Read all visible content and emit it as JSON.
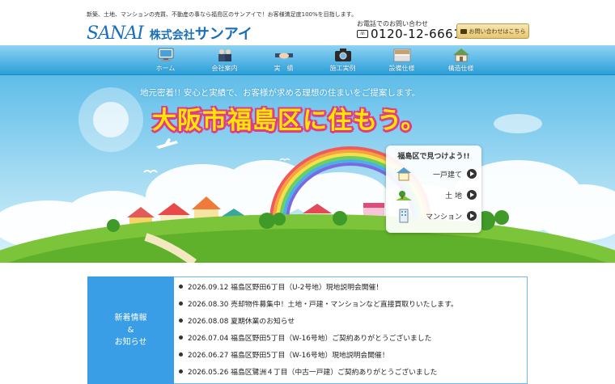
{
  "header": {
    "tagline": "新築、土地、マンションの売買、不動産の事なら福島区のサンアイで！お客様満足度100%を目指します。",
    "logo_mark": "SANAI",
    "company_prefix": "株式会社",
    "company_name": "サンアイ",
    "phone_label": "お電話でのお問い合わせ",
    "phone_icon_text": "☏",
    "phone_number": "0120-12-6661",
    "contact_button": "お問い合わせはこちら"
  },
  "nav": {
    "items": [
      {
        "label": "ホーム",
        "icon": "computer-icon"
      },
      {
        "label": "会社案内",
        "icon": "staff-icon"
      },
      {
        "label": "実　績",
        "icon": "handshake-icon"
      },
      {
        "label": "施工実例",
        "icon": "camera-icon"
      },
      {
        "label": "設備仕様",
        "icon": "kitchen-icon"
      },
      {
        "label": "構造仕様",
        "icon": "house-icon"
      }
    ]
  },
  "hero": {
    "subtitle": "地元密着!! 安心と実績で、お客様が求める理想の住まいをご提案します。",
    "title": "大阪市福島区に住もう。",
    "finder": {
      "title": "福島区で見つけよう!!",
      "items": [
        {
          "label": "一戸建て"
        },
        {
          "label": "土 地"
        },
        {
          "label": "マンション"
        }
      ]
    }
  },
  "news": {
    "label_line1": "新着情報",
    "label_line2": "&",
    "label_line3": "お知らせ",
    "items": [
      {
        "text": "2026.09.12 福島区野田6丁目（U-2号地）現地説明会開催！"
      },
      {
        "text": "2026.08.30 売却物件募集中！土地・戸建・マンションなど直接買取りいたします。"
      },
      {
        "text": "2026.08.08 夏期休業のお知らせ"
      },
      {
        "text": "2026.07.04 福島区野田5丁目（W-16号地）ご契約ありがとうございました"
      },
      {
        "text": "2026.06.27 福島区野田5丁目（W-16号地）現地説明会開催！"
      },
      {
        "text": "2026.05.26 福島区鷺洲４丁目（中古一戸建）ご契約ありがとうございました"
      }
    ]
  },
  "colors": {
    "brand_blue": "#1a6fb8",
    "nav_blue": "#2a9fd8",
    "title_yellow": "#ffe600",
    "title_outline": "#e03a8a",
    "news_label_bg": "#3a9ee6"
  }
}
